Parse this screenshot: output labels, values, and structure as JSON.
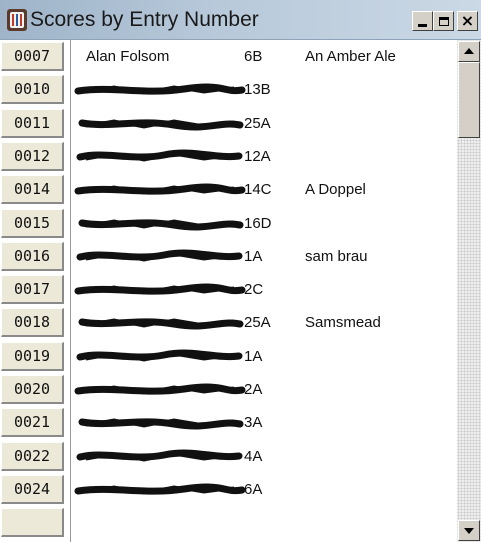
{
  "window": {
    "title": "Scores by Entry Number",
    "app_icon": "app-icon",
    "controls": {
      "minimize": "minimize-icon",
      "maximize": "maximize-icon",
      "close_glyph": "×"
    }
  },
  "rows": [
    {
      "entry": "0007",
      "name": "Alan Folsom",
      "category": "6B",
      "beer": "An Amber Ale",
      "redacted": false
    },
    {
      "entry": "0010",
      "name": "",
      "category": "13B",
      "beer": "",
      "redacted": true
    },
    {
      "entry": "0011",
      "name": "",
      "category": "25A",
      "beer": "",
      "redacted": true
    },
    {
      "entry": "0012",
      "name": "",
      "category": "12A",
      "beer": "",
      "redacted": true
    },
    {
      "entry": "0014",
      "name": "",
      "category": "14C",
      "beer": "A Doppel",
      "redacted": true
    },
    {
      "entry": "0015",
      "name": "",
      "category": "16D",
      "beer": "",
      "redacted": true
    },
    {
      "entry": "0016",
      "name": "",
      "category": "1A",
      "beer": "sam brau",
      "redacted": true
    },
    {
      "entry": "0017",
      "name": "",
      "category": "2C",
      "beer": "",
      "redacted": true
    },
    {
      "entry": "0018",
      "name": "",
      "category": "25A",
      "beer": "Samsmead",
      "redacted": true
    },
    {
      "entry": "0019",
      "name": "",
      "category": "1A",
      "beer": "",
      "redacted": true
    },
    {
      "entry": "0020",
      "name": "",
      "category": "2A",
      "beer": "",
      "redacted": true
    },
    {
      "entry": "0021",
      "name": "",
      "category": "3A",
      "beer": "",
      "redacted": true
    },
    {
      "entry": "0022",
      "name": "",
      "category": "4A",
      "beer": "",
      "redacted": true
    },
    {
      "entry": "0024",
      "name": "",
      "category": "6A",
      "beer": "",
      "redacted": true
    },
    {
      "entry": "",
      "name": "",
      "category": "",
      "beer": "",
      "redacted": false
    }
  ],
  "colors": {
    "titlebar_start": "#9fb4c9",
    "titlebar_end": "#cbd8e5",
    "button_face": "#ece9d8",
    "redaction": "#111111"
  },
  "scrollbar": {
    "up": "scroll-up-arrow-icon",
    "down": "scroll-down-arrow-icon"
  }
}
